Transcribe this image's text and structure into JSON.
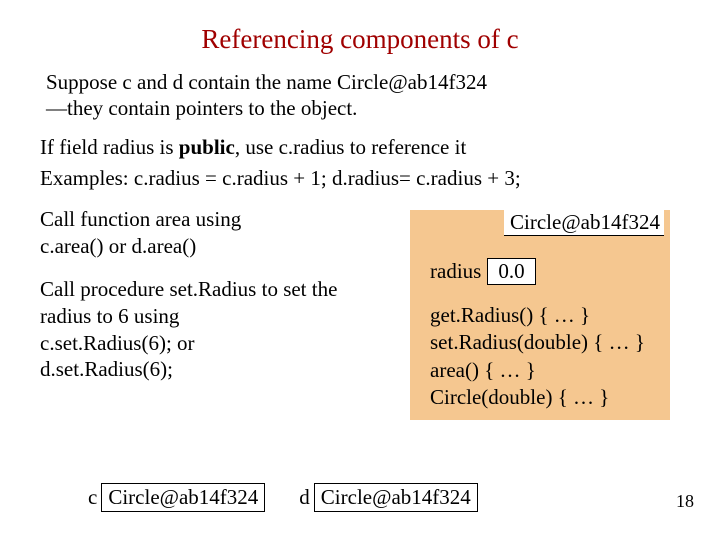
{
  "title": "Referencing components of c",
  "intro1": "Suppose c and d contain the name Circle@ab14f324",
  "intro2": "—they contain pointers to the object.",
  "field_prefix": "If field radius is ",
  "field_public": "public",
  "field_mid": ", use   c.radius   to reference it",
  "examples": "Examples: c.radius = c.radius + 1; d.radius= c.radius + 3;",
  "call_area1": "Call function area using",
  "call_area2": "c.area()   or   d.area()",
  "call_set1": "Call procedure set.Radius to set the radius to 6 using",
  "call_set2": "c.set.Radius(6);   or",
  "call_set3": "d.set.Radius(6);",
  "obj": {
    "label": "Circle@ab14f324",
    "radius_label": "radius",
    "radius_value": "0.0",
    "m1": "get.Radius() { … }",
    "m2": "set.Radius(double) { … }",
    "m3": "area() { … }",
    "m4": "Circle(double) { … }"
  },
  "c_label": "c",
  "c_box": "Circle@ab14f324",
  "d_label": "d",
  "d_box": "Circle@ab14f324",
  "pagenum": "18"
}
